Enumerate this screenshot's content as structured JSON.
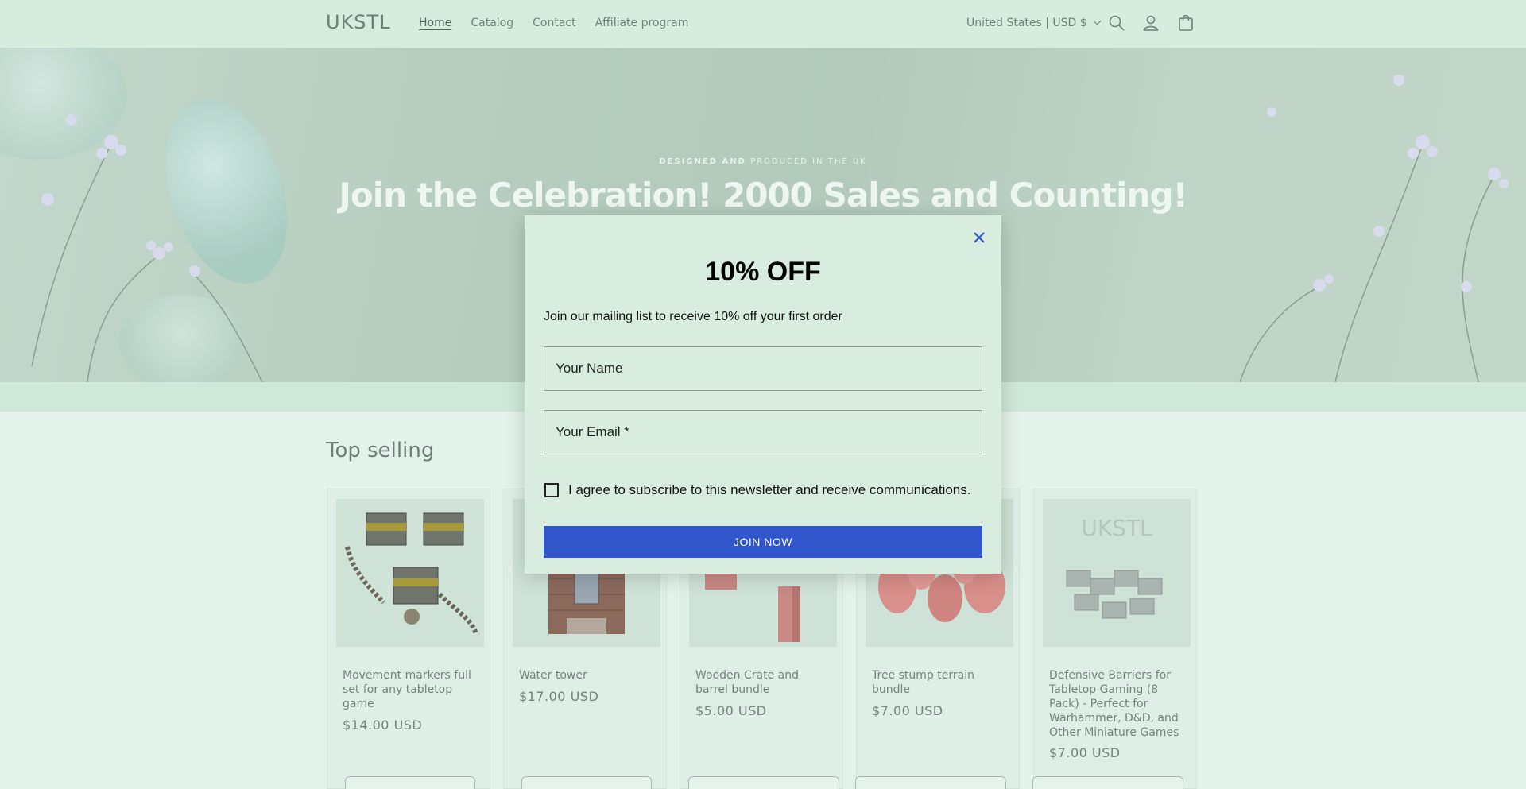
{
  "header": {
    "logo": "UKSTL",
    "nav": [
      {
        "label": "Home",
        "active": true
      },
      {
        "label": "Catalog",
        "active": false
      },
      {
        "label": "Contact",
        "active": false
      },
      {
        "label": "Affiliate program",
        "active": false
      }
    ],
    "country_selector": "United States | USD $",
    "icons": [
      "search-icon",
      "account-icon",
      "cart-icon"
    ]
  },
  "hero": {
    "subheading_bold": "DESIGNED AND",
    "subheading_rest": " PRODUCED IN THE UK",
    "title": "Join the Celebration! 2000 Sales and Counting!"
  },
  "products": {
    "section_title": "Top selling",
    "items": [
      {
        "name": "Movement markers full set for any tabletop game",
        "price": "$14.00 USD"
      },
      {
        "name": "Water tower",
        "price": "$17.00 USD"
      },
      {
        "name": "Wooden Crate and barrel bundle",
        "price": "$5.00 USD"
      },
      {
        "name": "Tree stump terrain bundle",
        "price": "$7.00 USD"
      },
      {
        "name": "Defensive Barriers for Tabletop Gaming (8 Pack) - Perfect for Warhammer, D&D, and Other Miniature Games",
        "price": "$7.00 USD"
      }
    ],
    "thumb_logo": "UKSTL"
  },
  "modal": {
    "title": "10% OFF",
    "description": "Join our mailing list to receive 10% off your first order",
    "name_placeholder": "Your Name",
    "email_placeholder": "Your Email *",
    "consent_label": "I agree to subscribe to this newsletter and receive communications.",
    "button_label": "JOIN NOW"
  },
  "colors": {
    "header_bg": "#d6ecdf",
    "page_bg": "#e3f2ea",
    "modal_bg": "#d8eddf",
    "button_bg": "#3156cc",
    "close_icon": "#3156cc"
  }
}
